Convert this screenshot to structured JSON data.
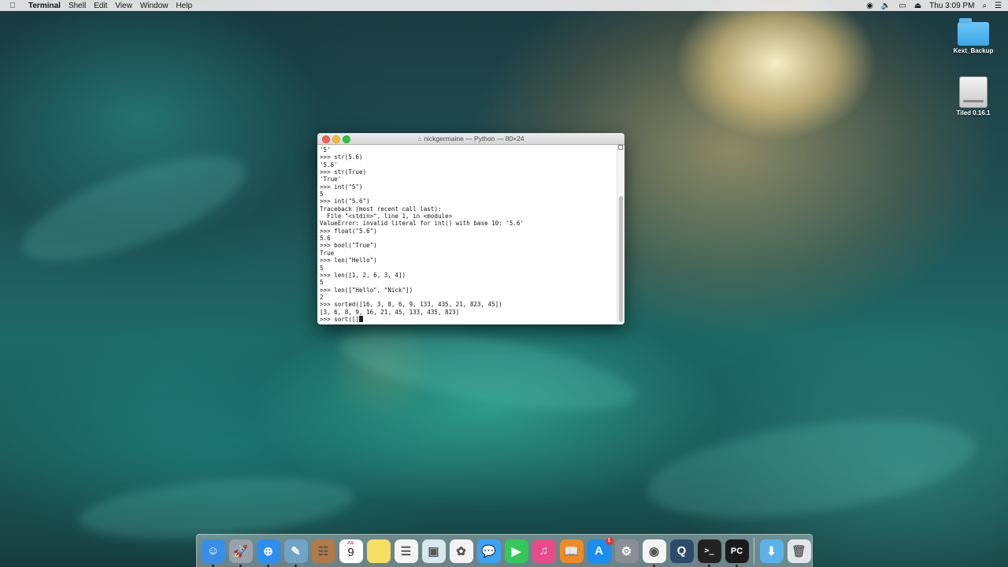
{
  "menubar": {
    "app_name": "Terminal",
    "menus": [
      "Shell",
      "Edit",
      "View",
      "Window",
      "Help"
    ],
    "clock": "Thu 3:09 PM"
  },
  "desktop_icons": [
    {
      "label": "Kext_Backup",
      "type": "folder"
    },
    {
      "label": "Tiled 0.16.1",
      "type": "drive"
    }
  ],
  "terminal": {
    "title": "nickgermaine — Python — 80×24",
    "lines": [
      "'5'",
      ">>> str(5.6)",
      "'5.6'",
      ">>> str(True)",
      "'True'",
      ">>> int(\"5\")",
      "5",
      ">>> int(\"5.6\")",
      "Traceback (most recent call last):",
      "  File \"<stdin>\", line 1, in <module>",
      "ValueError: invalid literal for int() with base 10: '5.6'",
      ">>> float(\"5.6\")",
      "5.6",
      ">>> bool(\"True\")",
      "True",
      ">>> len(\"Hello\")",
      "5",
      ">>> len([1, 2, 6, 3, 4])",
      "5",
      ">>> len([\"Hello\", \"Nick\"])",
      "2",
      ">>> sorted([16, 3, 8, 6, 9, 133, 435, 21, 823, 45])",
      "[3, 6, 8, 9, 16, 21, 45, 133, 435, 823]"
    ],
    "prompt_line": ">>> sort([]"
  },
  "dock": {
    "apps": [
      {
        "name": "finder",
        "color": "#3b8ee8"
      },
      {
        "name": "launchpad",
        "color": "#9aa3ad"
      },
      {
        "name": "safari",
        "color": "#2d8ef0"
      },
      {
        "name": "preview",
        "color": "#6fa3c8"
      },
      {
        "name": "contacts",
        "color": "#b07a4a"
      },
      {
        "name": "calendar",
        "color": "#ffffff",
        "month": "JUL",
        "day": "9"
      },
      {
        "name": "notes",
        "color": "#f7df63"
      },
      {
        "name": "reminders",
        "color": "#f5f5f5"
      },
      {
        "name": "photo-booth",
        "color": "#d9e7ee"
      },
      {
        "name": "photos",
        "color": "#f3f3f3"
      },
      {
        "name": "messages",
        "color": "#3aa3f5"
      },
      {
        "name": "facetime",
        "color": "#34c759"
      },
      {
        "name": "itunes",
        "color": "#e84a8b"
      },
      {
        "name": "ibooks",
        "color": "#f08a24"
      },
      {
        "name": "app-store",
        "color": "#1b8ef2",
        "badge": "1"
      },
      {
        "name": "system-preferences",
        "color": "#8a8f96"
      },
      {
        "name": "chrome",
        "color": "#f5f5f5"
      },
      {
        "name": "quicktime",
        "color": "#2c4b6b"
      },
      {
        "name": "terminal",
        "color": "#222222"
      },
      {
        "name": "pycharm",
        "color": "#1a1a1a",
        "label": "PC"
      }
    ],
    "right_items": [
      {
        "name": "downloads-folder",
        "color": "#5bb2ea"
      },
      {
        "name": "trash",
        "color": "#e2e6ea"
      }
    ]
  }
}
